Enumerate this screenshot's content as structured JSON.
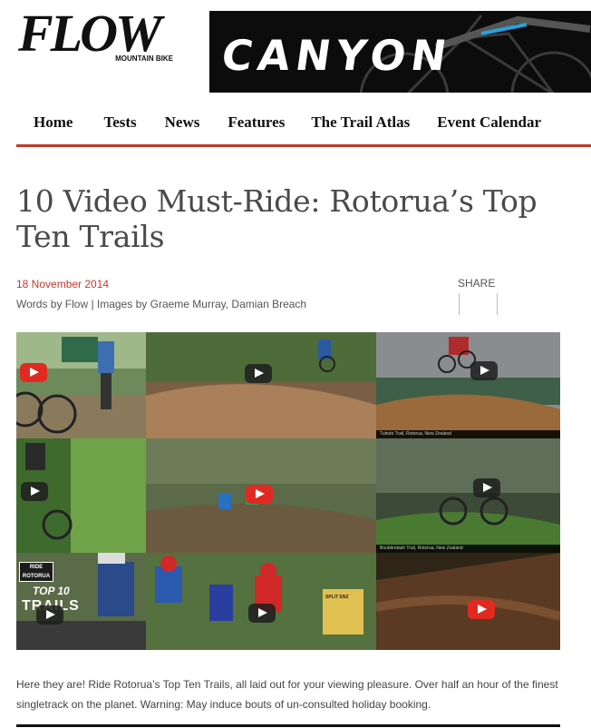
{
  "logo": {
    "main": "FLOW",
    "sub": "MOUNTAIN BIKE"
  },
  "banner": {
    "brand": "CANYON"
  },
  "nav": {
    "items": [
      "Home",
      "Tests",
      "News",
      "Features",
      "The Trail Atlas",
      "Event Calendar"
    ]
  },
  "article": {
    "title": "10 Video Must-Ride: Rotorua’s Top Ten Trails",
    "date": "18 November 2014",
    "byline": "Words by Flow | Images by Graeme Murray, Damian Breach",
    "share_label": "SHARE",
    "intro": "Here they are! Ride Rotorua’s Top Ten Trails, all laid out for your viewing pleasure. Over half an hour of the finest singletrack on the planet. Warning: May induce bouts of un-consulted holiday booking."
  },
  "videos": {
    "captions": [
      "Tuhoto Trail, Rotorua, New Zealand",
      "Tuhoto Trail, Rotorua, New Zealand",
      "Boulderdash Trail, Rotorua, New Zealand"
    ],
    "overlay": {
      "rotorua_badge": "RIDE ROTORUA",
      "top10": "TOP 10",
      "trails": "TRAILS",
      "sign": "SPLIT ENZ"
    }
  },
  "colors": {
    "accent": "#c0392b",
    "play_red": "#e02a21"
  }
}
